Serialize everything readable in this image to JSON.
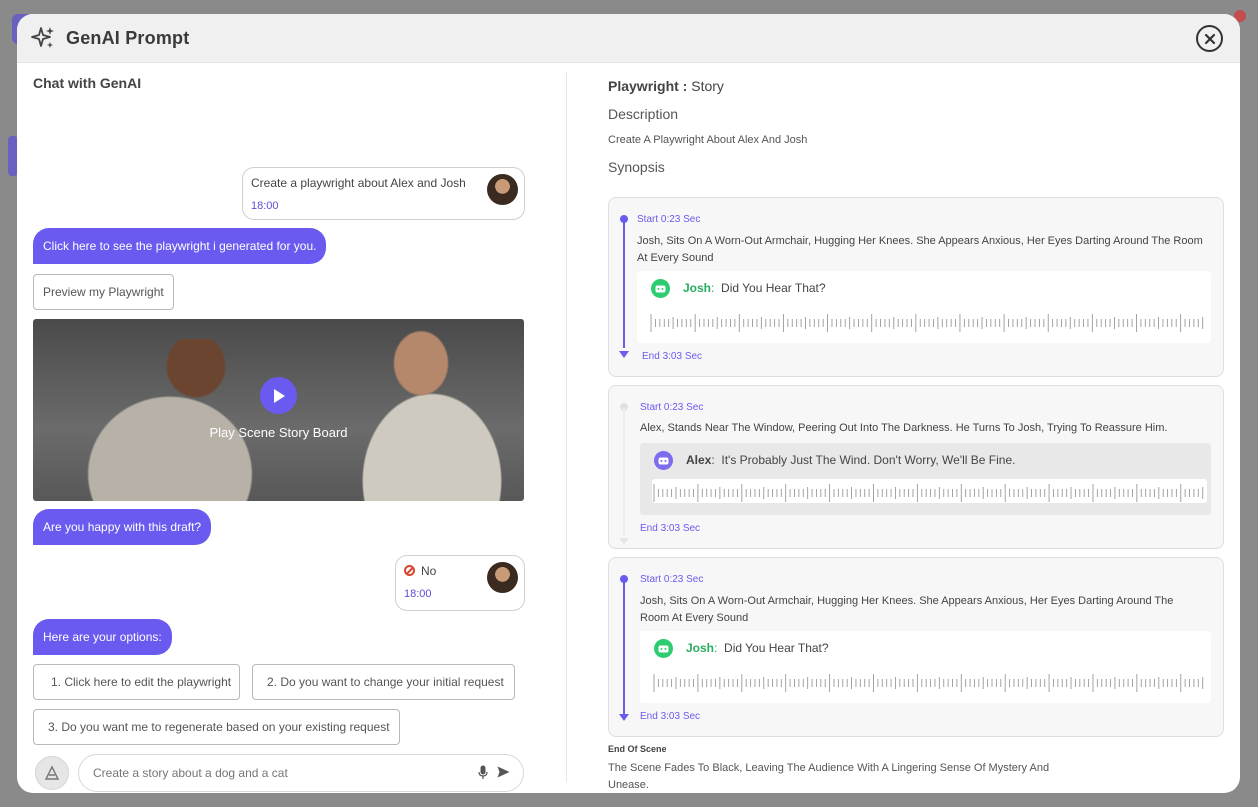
{
  "app": {
    "title": "GenAI Prompt"
  },
  "chat": {
    "title": "Chat with GenAI",
    "messages": {
      "user1": {
        "text": "Create a playwright about Alex and Josh",
        "time": "18:00"
      },
      "bot1": "Click here to see the playwright i generated for you.",
      "preview_button": "Preview my Playwright",
      "video_label": "Play Scene Story Board",
      "bot2": "Are you happy with this draft?",
      "user2": {
        "text": "No",
        "time": "18:00"
      },
      "bot3": "Here are your options:"
    },
    "options": [
      "1. Click here to edit the playwright",
      "2. Do you want to change your initial request",
      "3. Do you want me to regenerate based on your existing request"
    ],
    "input_placeholder": "Create a story about a dog and a cat"
  },
  "playwright": {
    "label": "Playwright :",
    "value": "Story",
    "description_heading": "Description",
    "description_text": "Create A Playwright About Alex And Josh",
    "synopsis_heading": "Synopsis",
    "scenes": [
      {
        "start": "Start 0:23 Sec",
        "text": "Josh, Sits On A Worn-Out Armchair, Hugging Her Knees. She Appears Anxious, Her Eyes Darting Around The Room At Every Sound",
        "speaker": "Josh",
        "line": "Did You Hear That?",
        "end": "End 3:03 Sec"
      },
      {
        "start": "Start 0:23 Sec",
        "text": "Alex, Stands Near The Window, Peering Out Into The Darkness. He Turns To Josh, Trying To Reassure Him.",
        "speaker": "Alex",
        "line": "It's Probably Just The Wind. Don't Worry, We'll Be Fine.",
        "end": "End 3:03 Sec"
      },
      {
        "start": "Start 0:23 Sec",
        "text": "Josh, Sits On A Worn-Out Armchair, Hugging Her Knees. She Appears Anxious, Her Eyes Darting Around The Room At Every Sound",
        "speaker": "Josh",
        "line": "Did You Hear That?",
        "end": "End 3:03 Sec"
      }
    ],
    "end_of_scene_heading": "End Of Scene",
    "end_of_scene_text": "The Scene Fades To Black, Leaving The Audience With A Lingering Sense Of Mystery And Unease."
  },
  "colors": {
    "accent": "#6a5af0",
    "josh_icon": "#2ecc71",
    "alex_icon": "#7b6cf0",
    "josh_name": "#27ae60"
  }
}
